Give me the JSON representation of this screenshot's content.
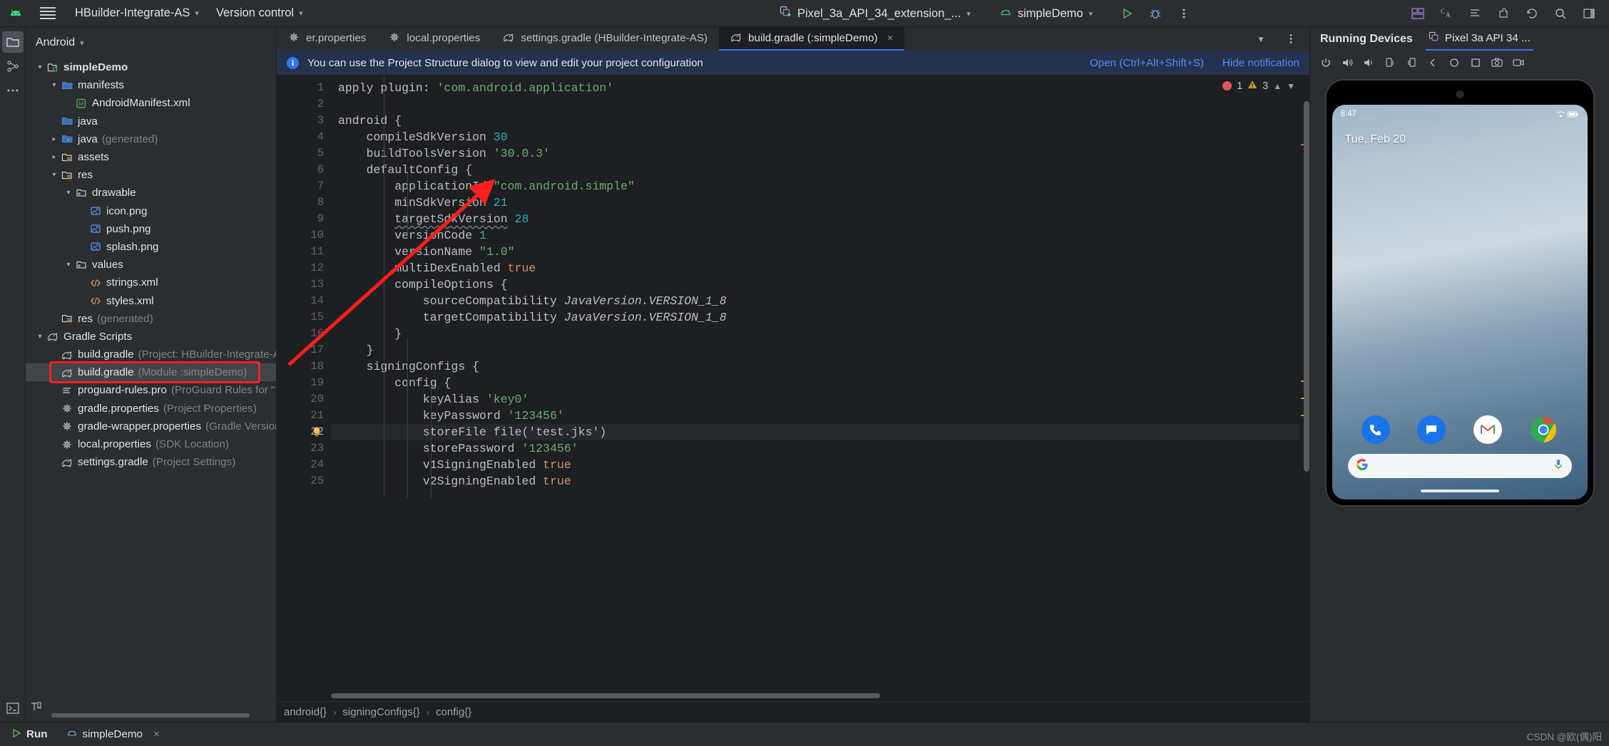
{
  "topbar": {
    "android_logo": "android-logo",
    "menu_icon": "hamburger-menu-icon",
    "project_name": "HBuilder-Integrate-AS",
    "vcs_label": "Version control",
    "device_selector": "Pixel_3a_API_34_extension_...",
    "run_config": "simpleDemo",
    "run_icon": "run-icon",
    "debug_icon": "debug-icon",
    "more_icon": "more-vertical-icon",
    "right_icons": [
      "layout-inspector-icon",
      "translate-icon",
      "notifications-icon",
      "plugins-icon",
      "updates-icon",
      "search-icon",
      "sidebar-right-icon"
    ]
  },
  "rail": {
    "items": [
      {
        "name": "project-tool-window",
        "icon": "folder-icon",
        "selected": true
      },
      {
        "name": "structure-tool-window",
        "icon": "structure-icon",
        "selected": false
      },
      {
        "name": "more-tool-windows",
        "icon": "ellipsis-icon",
        "selected": false
      }
    ],
    "bottom_item": {
      "name": "terminal-tool-window",
      "icon": "terminal-icon"
    }
  },
  "tree": {
    "view_label": "Android",
    "rows": [
      {
        "indent": 0,
        "arrow": "down",
        "icon": "module-icon",
        "label": "simpleDemo",
        "sub": "",
        "bold": true,
        "selected": false
      },
      {
        "indent": 1,
        "arrow": "down",
        "icon": "folder-blue-icon",
        "label": "manifests",
        "sub": "",
        "bold": false,
        "selected": false
      },
      {
        "indent": 2,
        "arrow": "none",
        "icon": "manifest-icon",
        "label": "AndroidManifest.xml",
        "sub": "",
        "bold": false,
        "selected": false
      },
      {
        "indent": 1,
        "arrow": "none",
        "icon": "folder-blue-icon",
        "label": "java",
        "sub": "",
        "bold": false,
        "selected": false
      },
      {
        "indent": 1,
        "arrow": "right",
        "icon": "folder-gen-icon",
        "label": "java",
        "sub": "(generated)",
        "bold": false,
        "selected": false
      },
      {
        "indent": 1,
        "arrow": "right",
        "icon": "folder-assets-icon",
        "label": "assets",
        "sub": "",
        "bold": false,
        "selected": false
      },
      {
        "indent": 1,
        "arrow": "down",
        "icon": "folder-assets-icon",
        "label": "res",
        "sub": "",
        "bold": false,
        "selected": false
      },
      {
        "indent": 2,
        "arrow": "down",
        "icon": "folder-res-icon",
        "label": "drawable",
        "sub": "",
        "bold": false,
        "selected": false
      },
      {
        "indent": 3,
        "arrow": "none",
        "icon": "image-icon",
        "label": "icon.png",
        "sub": "",
        "bold": false,
        "selected": false
      },
      {
        "indent": 3,
        "arrow": "none",
        "icon": "image-icon",
        "label": "push.png",
        "sub": "",
        "bold": false,
        "selected": false
      },
      {
        "indent": 3,
        "arrow": "none",
        "icon": "image-icon",
        "label": "splash.png",
        "sub": "",
        "bold": false,
        "selected": false
      },
      {
        "indent": 2,
        "arrow": "down",
        "icon": "folder-res-icon",
        "label": "values",
        "sub": "",
        "bold": false,
        "selected": false
      },
      {
        "indent": 3,
        "arrow": "none",
        "icon": "xml-icon",
        "label": "strings.xml",
        "sub": "",
        "bold": false,
        "selected": false
      },
      {
        "indent": 3,
        "arrow": "none",
        "icon": "xml-icon",
        "label": "styles.xml",
        "sub": "",
        "bold": false,
        "selected": false
      },
      {
        "indent": 1,
        "arrow": "none",
        "icon": "folder-assets-icon",
        "label": "res",
        "sub": "(generated)",
        "bold": false,
        "selected": false
      },
      {
        "indent": 0,
        "arrow": "down",
        "icon": "gradle-icon",
        "label": "Gradle Scripts",
        "sub": "",
        "bold": false,
        "selected": false
      },
      {
        "indent": 1,
        "arrow": "none",
        "icon": "gradle-icon",
        "label": "build.gradle",
        "sub": "(Project: HBuilder-Integrate-AS)",
        "bold": false,
        "selected": false
      },
      {
        "indent": 1,
        "arrow": "none",
        "icon": "gradle-icon",
        "label": "build.gradle",
        "sub": "(Module :simpleDemo)",
        "bold": false,
        "selected": true
      },
      {
        "indent": 1,
        "arrow": "none",
        "icon": "proguard-icon",
        "label": "proguard-rules.pro",
        "sub": "(ProGuard Rules for \":sim",
        "bold": false,
        "selected": false
      },
      {
        "indent": 1,
        "arrow": "none",
        "icon": "gear-icon",
        "label": "gradle.properties",
        "sub": "(Project Properties)",
        "bold": false,
        "selected": false
      },
      {
        "indent": 1,
        "arrow": "none",
        "icon": "gear-icon",
        "label": "gradle-wrapper.properties",
        "sub": "(Gradle Version)",
        "bold": false,
        "selected": false
      },
      {
        "indent": 1,
        "arrow": "none",
        "icon": "gear-icon",
        "label": "local.properties",
        "sub": "(SDK Location)",
        "bold": false,
        "selected": false
      },
      {
        "indent": 1,
        "arrow": "none",
        "icon": "gradle-icon",
        "label": "settings.gradle",
        "sub": "(Project Settings)",
        "bold": false,
        "selected": false
      }
    ]
  },
  "editor": {
    "tabs": [
      {
        "label": "er.properties",
        "icon": "gear-icon",
        "active": false,
        "closable": false
      },
      {
        "label": "local.properties",
        "icon": "gear-icon",
        "active": false,
        "closable": false
      },
      {
        "label": "settings.gradle (HBuilder-Integrate-AS)",
        "icon": "gradle-icon",
        "active": false,
        "closable": false
      },
      {
        "label": "build.gradle (:simpleDemo)",
        "icon": "gradle-icon",
        "active": true,
        "closable": true
      }
    ],
    "tab_close_glyph": "×",
    "tab_dropdown_icon": "chevron-down-icon",
    "tab_options_icon": "more-vertical-icon",
    "notification": {
      "icon": "info-icon",
      "text": "You can use the Project Structure dialog to view and edit your project configuration",
      "open_action": "Open (Ctrl+Alt+Shift+S)",
      "hide_action": "Hide notification"
    },
    "inspections": {
      "error_count": "1",
      "warning_count": "3",
      "up_icon": "chevron-up-icon",
      "down_icon": "chevron-down-icon"
    },
    "lines": [
      {
        "n": 1,
        "text": "apply plugin: 'com.android.application'"
      },
      {
        "n": 2,
        "text": ""
      },
      {
        "n": 3,
        "text": "android {"
      },
      {
        "n": 4,
        "text": "    compileSdkVersion 30"
      },
      {
        "n": 5,
        "text": "    buildToolsVersion '30.0.3'"
      },
      {
        "n": 6,
        "text": "    defaultConfig {"
      },
      {
        "n": 7,
        "text": "        applicationId \"com.android.simple\""
      },
      {
        "n": 8,
        "text": "        minSdkVersion 21"
      },
      {
        "n": 9,
        "text": "        targetSdkVersion 28"
      },
      {
        "n": 10,
        "text": "        versionCode 1"
      },
      {
        "n": 11,
        "text": "        versionName \"1.0\""
      },
      {
        "n": 12,
        "text": "        multiDexEnabled true"
      },
      {
        "n": 13,
        "text": "        compileOptions {"
      },
      {
        "n": 14,
        "text": "            sourceCompatibility JavaVersion.VERSION_1_8"
      },
      {
        "n": 15,
        "text": "            targetCompatibility JavaVersion.VERSION_1_8"
      },
      {
        "n": 16,
        "text": "        }"
      },
      {
        "n": 17,
        "text": "    }"
      },
      {
        "n": 18,
        "text": "    signingConfigs {"
      },
      {
        "n": 19,
        "text": "        config {"
      },
      {
        "n": 20,
        "text": "            keyAlias 'key0'"
      },
      {
        "n": 21,
        "text": "            keyPassword '123456'"
      },
      {
        "n": 22,
        "text": "            storeFile file('test.jks')"
      },
      {
        "n": 23,
        "text": "            storePassword '123456'"
      },
      {
        "n": 24,
        "text": "            v1SigningEnabled true"
      },
      {
        "n": 25,
        "text": "            v2SigningEnabled true"
      }
    ],
    "current_line": 22,
    "bulb_icon": "intention-bulb-icon",
    "selection_text": "test.jks",
    "breadcrumb": [
      "android{}",
      "signingConfigs{}",
      "config{}"
    ],
    "breadcrumb_separator": "›"
  },
  "devices": {
    "panel_title": "Running Devices",
    "tab_label": "Pixel 3a API 34 ...",
    "tab_icon": "device-icon",
    "toolbar_icons": [
      "power-icon",
      "volume-up-icon",
      "volume-down-icon",
      "rotate-left-icon",
      "rotate-right-icon",
      "back-icon",
      "home-icon",
      "overview-icon",
      "screenshot-icon",
      "record-icon"
    ],
    "phone": {
      "status_time": "8:47",
      "status_right": "battery-wifi-icons",
      "date_text": "Tue, Feb 20",
      "dock_apps": [
        "phone-app-icon",
        "messages-app-icon",
        "gmail-app-icon",
        "chrome-app-icon"
      ],
      "search_placeholder": "",
      "search_icon": "google-g-icon",
      "mic_icon": "microphone-icon"
    }
  },
  "bottombar": {
    "run_label": "Run",
    "run_icon": "run-icon",
    "session_label": "simpleDemo",
    "session_icon": "android-icon",
    "close_glyph": "×"
  },
  "watermark": "CSDN @欧(偶)阳",
  "colors": {
    "accent_blue": "#3574f0",
    "annotation_red": "#ff1f1f",
    "string_green": "#6aab73",
    "keyword_orange": "#cf8e6d",
    "number_cyan": "#2aacb8",
    "selection_blue": "#214283",
    "notif_bg": "#25324d"
  }
}
